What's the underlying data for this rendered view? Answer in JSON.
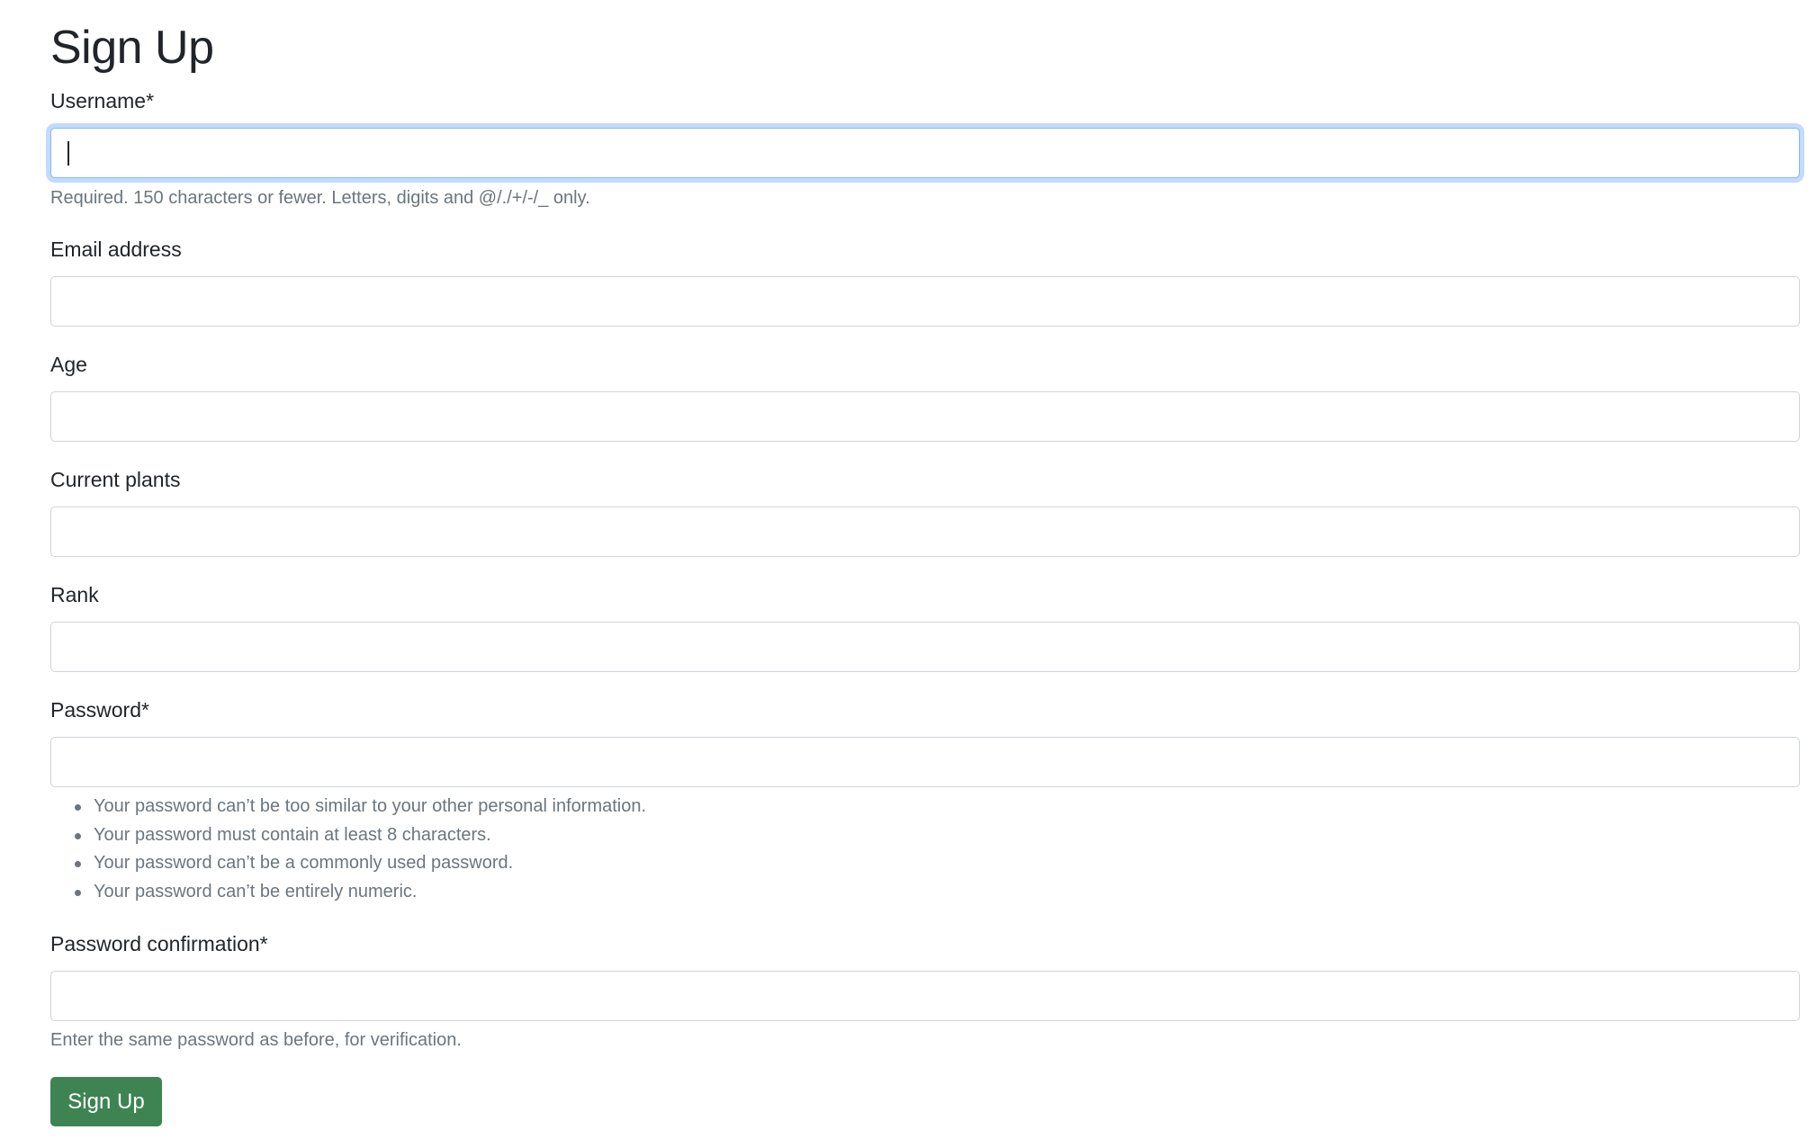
{
  "page": {
    "title": "Sign Up"
  },
  "form": {
    "username": {
      "label": "Username*",
      "value": "",
      "help": "Required. 150 characters or fewer. Letters, digits and @/./+/-/_ only."
    },
    "email": {
      "label": "Email address",
      "value": ""
    },
    "age": {
      "label": "Age",
      "value": ""
    },
    "current_plants": {
      "label": "Current plants",
      "value": ""
    },
    "rank": {
      "label": "Rank",
      "value": ""
    },
    "password": {
      "label": "Password*",
      "value": "",
      "rules": [
        "Your password can’t be too similar to your other personal information.",
        "Your password must contain at least 8 characters.",
        "Your password can’t be a commonly used password.",
        "Your password can’t be entirely numeric."
      ]
    },
    "password_confirmation": {
      "label": "Password confirmation*",
      "value": "",
      "help": "Enter the same password as before, for verification."
    },
    "submit_label": "Sign Up"
  },
  "colors": {
    "button_bg": "#3e8453",
    "focus_border": "#86b7fe",
    "help_text": "#6c757d",
    "text": "#212529"
  }
}
